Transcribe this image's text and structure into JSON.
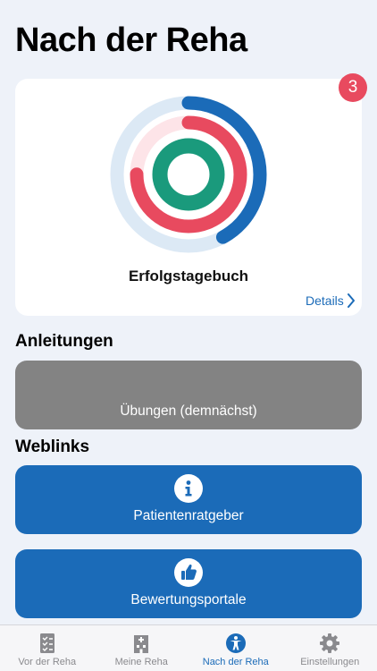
{
  "header": {
    "title": "Nach der Reha"
  },
  "card": {
    "badge_count": "3",
    "label": "Erfolgstagebuch",
    "details_label": "Details",
    "rings": [
      {
        "name": "outer",
        "color": "#1b6bb8",
        "track": "#dce9f5",
        "progress": 0.42
      },
      {
        "name": "middle",
        "color": "#e84a5f",
        "track": "#fde4e8",
        "progress": 0.75
      },
      {
        "name": "inner",
        "color": "#1a9a7c",
        "track": "#d6efe8",
        "progress": 1.0
      }
    ]
  },
  "sections": {
    "instructions": {
      "title": "Anleitungen",
      "tile_label": "Übungen (demnächst)"
    },
    "weblinks": {
      "title": "Weblinks",
      "tiles": [
        {
          "label": "Patientenratgeber",
          "icon": "info-icon"
        },
        {
          "label": "Bewertungsportale",
          "icon": "thumbs-up-icon"
        }
      ]
    }
  },
  "tabbar": {
    "tabs": [
      {
        "label": "Vor der Reha",
        "icon": "checklist-icon",
        "active": false
      },
      {
        "label": "Meine Reha",
        "icon": "hospital-icon",
        "active": false
      },
      {
        "label": "Nach der Reha",
        "icon": "accessibility-icon",
        "active": true
      },
      {
        "label": "Einstellungen",
        "icon": "gear-icon",
        "active": false
      }
    ]
  }
}
